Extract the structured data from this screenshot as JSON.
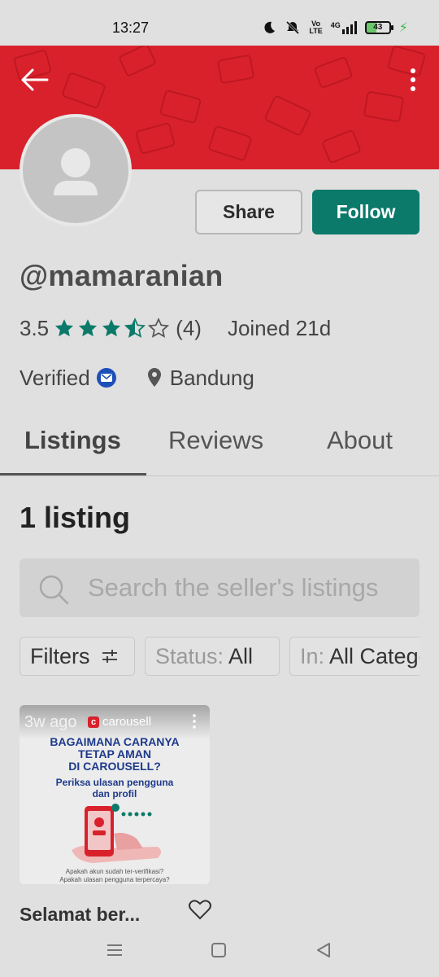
{
  "status_bar": {
    "time": "13:27",
    "net_top": "Vo",
    "net_bottom": "LTE",
    "signal_label": "4G",
    "battery": "43"
  },
  "profile": {
    "username": "@mamaranian",
    "rating": "3.5",
    "review_count": "(4)",
    "rating_stars": 3.5,
    "joined": "Joined 21d",
    "verified": "Verified",
    "location": "Bandung"
  },
  "actions": {
    "share_label": "Share",
    "follow_label": "Follow"
  },
  "tabs": [
    {
      "label": "Listings"
    },
    {
      "label": "Reviews"
    },
    {
      "label": "About"
    }
  ],
  "listings": {
    "count_label": "1 listing",
    "search_placeholder": "Search the seller's listings",
    "filters_label": "Filters",
    "status_key": "Status:",
    "status_value": "All",
    "in_key": "In:",
    "in_value": "All Categories"
  },
  "card": {
    "time": "3w ago",
    "brand": "carousell",
    "headline_1": "BAGAIMANA CARANYA",
    "headline_2": "TETAP AMAN",
    "headline_3": "DI CAROUSELL?",
    "sub_1": "Periksa ulasan pengguna",
    "sub_2": "dan profil",
    "foot_1": "Apakah akun sudah ter-verifikasi?",
    "foot_2": "Apakah ulasan pengguna terpercaya?",
    "title": "Selamat ber..."
  },
  "colors": {
    "brand_red": "#d9212c",
    "follow_green": "#0b7a6a",
    "star_green": "#0b7a6a",
    "verified_blue": "#1d4fb8"
  }
}
